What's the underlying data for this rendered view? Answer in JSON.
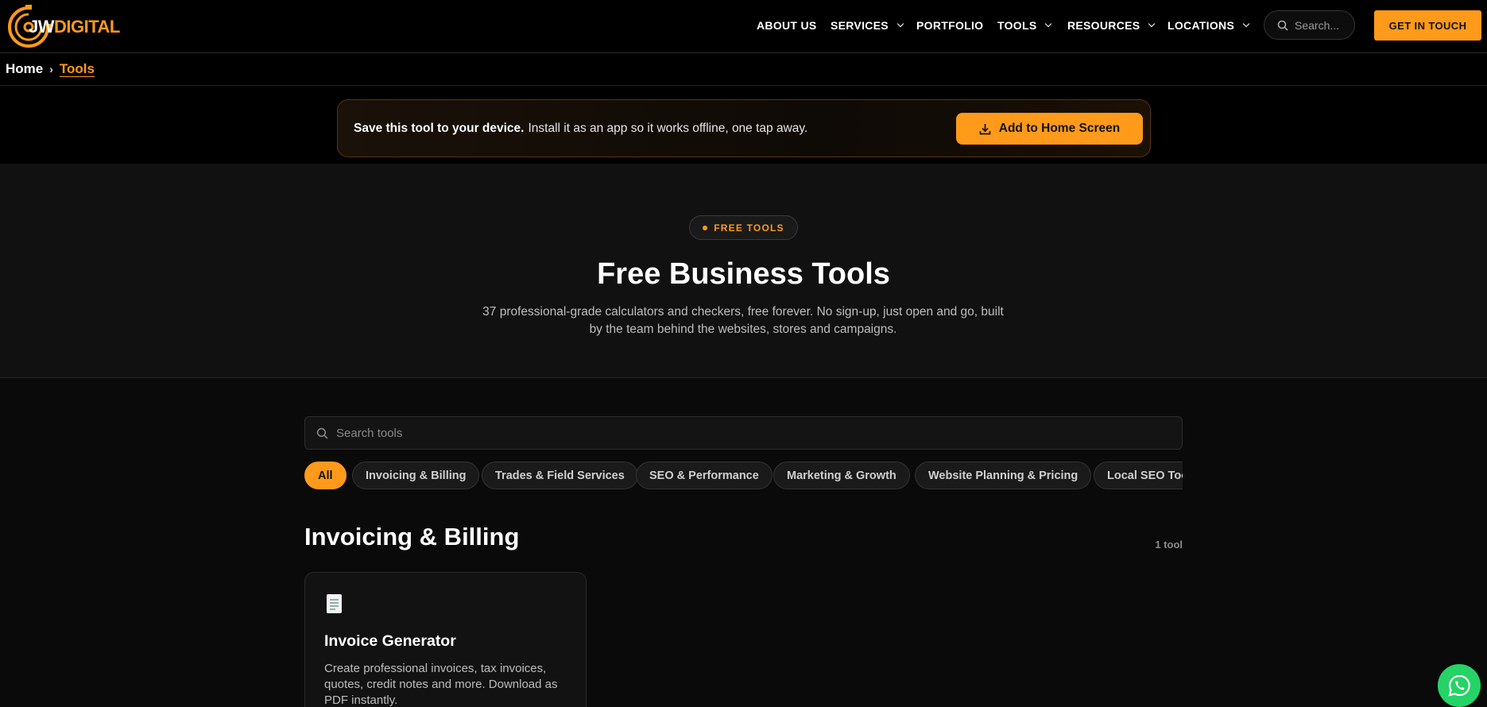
{
  "brand": {
    "logo_jw": "JW",
    "logo_digital": "DIGITAL",
    "accent": "#ff9a1a"
  },
  "nav": {
    "items": [
      {
        "label": "ABOUT US",
        "dropdown": false
      },
      {
        "label": "SERVICES",
        "dropdown": true
      },
      {
        "label": "PORTFOLIO",
        "dropdown": false
      },
      {
        "label": "TOOLS",
        "dropdown": true
      },
      {
        "label": "RESOURCES",
        "dropdown": true
      },
      {
        "label": "LOCATIONS",
        "dropdown": true
      }
    ],
    "search_placeholder": "Search...",
    "cta_label": "GET IN TOUCH"
  },
  "breadcrumb": {
    "home": "Home",
    "separator": "›",
    "current": "Tools"
  },
  "install": {
    "strong": "Save this tool to your device.",
    "text": "Install it as an app so it works offline, one tap away.",
    "button_label": "Add to Home Screen"
  },
  "hero": {
    "badge": "FREE TOOLS",
    "title": "Free Business Tools",
    "subtitle": "37 professional-grade calculators and checkers, free forever. No sign-up, just open and go, built by the team behind the websites, stores and campaigns."
  },
  "tools": {
    "search_placeholder": "Search tools",
    "filters": [
      "All",
      "Invoicing & Billing",
      "Trades & Field Services",
      "SEO & Performance",
      "Marketing & Growth",
      "Website Planning & Pricing",
      "Local SEO Tools"
    ],
    "active_filter": "All",
    "section_title": "Invoicing & Billing",
    "section_count": "1 tool",
    "cards": [
      {
        "title": "Invoice Generator",
        "description": "Create professional invoices, tax invoices, quotes, credit notes and more. Download as PDF instantly.",
        "icon": "document-icon"
      }
    ]
  }
}
